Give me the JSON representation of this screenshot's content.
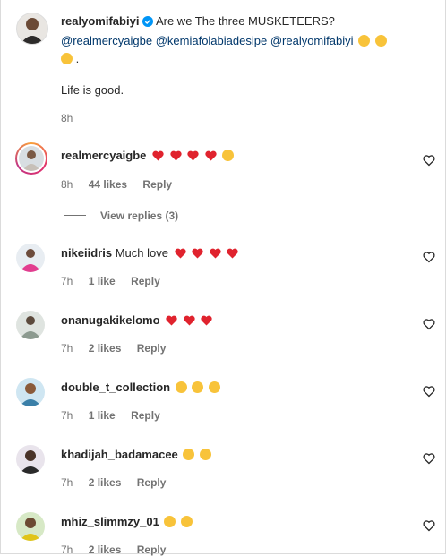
{
  "post": {
    "username": "realyomifabiyi",
    "verified": true,
    "caption_line1": "Are we The three MUSKETEERS?",
    "mentions": [
      "@realmercyaigbe",
      "@kemiafolabiadesipe",
      "@realyomifabiyi"
    ],
    "caption_end": ".",
    "caption_line3": "Life is good.",
    "time": "8h"
  },
  "comments": [
    {
      "username": "realmercyaigbe",
      "text": "",
      "emojis": [
        "red-heart",
        "red-heart",
        "red-heart",
        "red-heart",
        "laughing-face"
      ],
      "time": "8h",
      "likes": "44 likes",
      "reply": "Reply",
      "view_replies": "View replies (3)"
    },
    {
      "username": "nikeiidris",
      "text": "Much love",
      "emojis": [
        "red-heart",
        "red-heart",
        "red-heart",
        "red-heart"
      ],
      "time": "7h",
      "likes": "1 like",
      "reply": "Reply"
    },
    {
      "username": "onanugakikelomo",
      "text": "",
      "emojis": [
        "red-heart",
        "red-heart",
        "red-heart"
      ],
      "time": "7h",
      "likes": "2 likes",
      "reply": "Reply"
    },
    {
      "username": "double_t_collection",
      "text": "",
      "emojis": [
        "heart-eyes-face",
        "heart-eyes-face",
        "heart-eyes-face"
      ],
      "time": "7h",
      "likes": "1 like",
      "reply": "Reply"
    },
    {
      "username": "khadijah_badamacee",
      "text": "",
      "emojis": [
        "heart-eyes-face",
        "heart-eyes-face"
      ],
      "time": "7h",
      "likes": "2 likes",
      "reply": "Reply"
    },
    {
      "username": "mhiz_slimmzy_01",
      "text": "",
      "emojis": [
        "laughing-face",
        "laughing-face"
      ],
      "time": "7h",
      "likes": "2 likes",
      "reply": "Reply"
    }
  ],
  "colors": {
    "text": "#262626",
    "meta": "#737373",
    "mention": "#00376b",
    "verified": "#0095f6",
    "heart": "#ed4956"
  }
}
